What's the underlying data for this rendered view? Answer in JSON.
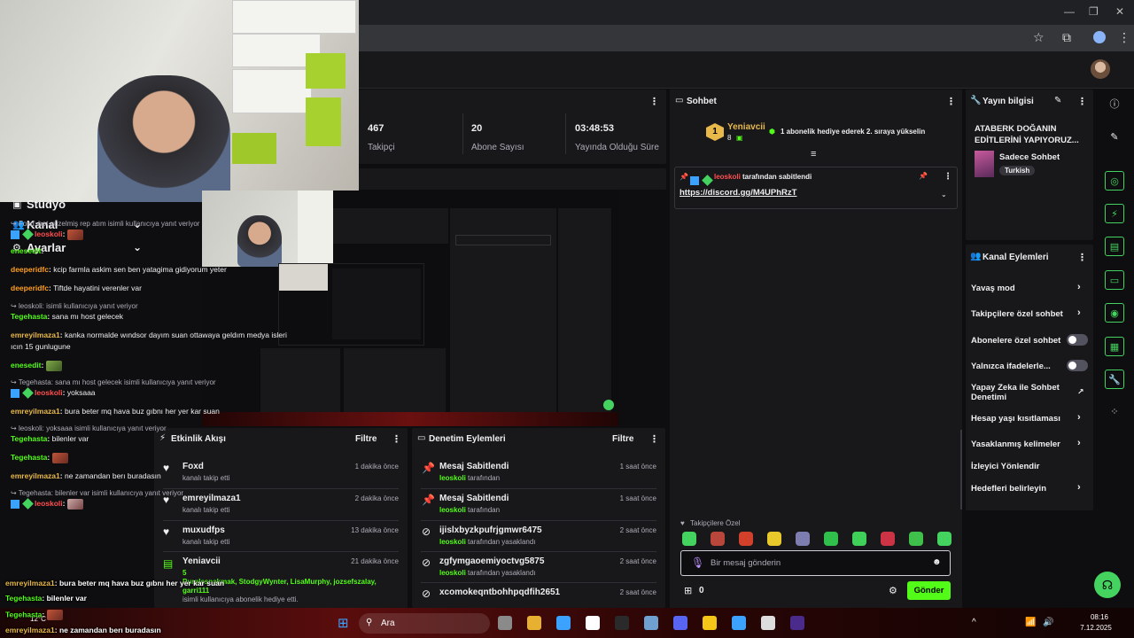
{
  "browser": {
    "star_icon": "star-icon",
    "ext_icon": "puzzle-icon",
    "menu_icon": "kebab-icon"
  },
  "stats": [
    {
      "value": "467",
      "label": "Takipçi"
    },
    {
      "value": "20",
      "label": "Abone Sayısı"
    },
    {
      "value": "03:48:53",
      "label": "Yayında Olduğu Süre"
    }
  ],
  "sidebar": {
    "items": [
      {
        "label": "Stüdyo"
      },
      {
        "label": "Kanal"
      },
      {
        "label": "Ayarlar"
      }
    ]
  },
  "activity": {
    "title": "Etkinlik Akışı",
    "filter": "Filtre",
    "items": [
      {
        "name": "Foxd",
        "sub": "kanalı takip etti",
        "time": "1 dakika önce"
      },
      {
        "name": "emreyilmaza1",
        "sub": "kanalı takip etti",
        "time": "2 dakika önce"
      },
      {
        "name": "muxudfps",
        "sub": "kanalı takip etti",
        "time": "13 dakika önce"
      },
      {
        "name": "Yeniavcii",
        "count": "5",
        "gifted": "Purplesnakmak, StodgyWynter, LisaMurphy, jozsefszalay, garri111",
        "sub": "isimli kullanıcıya abonelik hediye etti.",
        "time": "21 dakika önce"
      }
    ]
  },
  "modlog": {
    "title": "Denetim Eylemleri",
    "filter": "Filtre",
    "items": [
      {
        "name": "Mesaj Sabitlendi",
        "user": "leoskoli",
        "sub": "tarafından",
        "time": "1 saat önce"
      },
      {
        "name": "Mesaj Sabitlendi",
        "user": "leoskoli",
        "sub": "tarafından",
        "time": "1 saat önce"
      },
      {
        "name": "ijislxbyzkpufrjgmwr6475",
        "user": "leoskoli",
        "sub": "tarafından yasaklandı",
        "time": "2 saat önce"
      },
      {
        "name": "zgfymgaoemiyoctvg5875",
        "user": "leoskoli",
        "sub": "tarafından yasaklandı",
        "time": "2 saat önce"
      },
      {
        "name": "xcomokeqntbohhpqdfih2651",
        "user": "",
        "sub": "",
        "time": "2 saat önce"
      }
    ]
  },
  "chat": {
    "title": "Sohbet",
    "top_gifter": {
      "rank": "1",
      "name": "Yeniavcii",
      "count": "8"
    },
    "gift_prompt": "1 abonelik hediye ederek 2. sıraya yükselin",
    "pinned": {
      "by_user": "leoskoli",
      "by_text": "tarafından sabitlendi",
      "link": "https://discord.gg/M4UPhRzT"
    },
    "lines": [
      {
        "reply": "Foxd: bot güzelmiş rep atım isimli kullanıcıya yanıt veriyor"
      },
      {
        "user": "leoskoli",
        "text": ""
      },
      {
        "user": "enesedit",
        "text": ""
      },
      {
        "user": "deeperidfc",
        "text": "kcip farmla askim sen ben yatagima gidiyorum yeter"
      },
      {
        "user": "deeperidfc",
        "text": "Tiftde hayatini verenler var"
      },
      {
        "reply": "leoskoli: isimli kullanıcıya yanıt veriyor"
      },
      {
        "user": "Tegehasta",
        "text": "sana mı host gelecek"
      },
      {
        "user": "emreyilmaza1",
        "text": "kanka normalde wındsor dayım suan ottawaya geldım medya isleri ıcın 15 gunlugune"
      },
      {
        "user": "enesedit",
        "text": ""
      },
      {
        "reply": "Tegehasta: sana mı host gelecek isimli kullanıcıya yanıt veriyor"
      },
      {
        "user": "leoskoli",
        "text": "yoksaaa"
      },
      {
        "user": "emreyilmaza1",
        "text": "bura beter mq hava buz gıbnı her yer kar suan"
      },
      {
        "reply": "leoskoli: yoksaaa isimli kullanıcıya yanıt veriyor"
      },
      {
        "user": "Tegehasta",
        "text": "bilenler var"
      },
      {
        "user": "Tegehasta",
        "text": ""
      },
      {
        "user": "emreyilmaza1",
        "text": "ne zamandan berı buradasın"
      },
      {
        "reply": "Tegehasta: bilenler var isimli kullanıcıya yanıt veriyor"
      },
      {
        "user": "leoskoli",
        "text": ""
      }
    ],
    "follower_label": "Takipçilere Özel",
    "input_placeholder": "Bir mesaj gönderin",
    "points": "0",
    "send_label": "Gönder"
  },
  "stream_info": {
    "title_label": "Yayın bilgisi",
    "stream_title": "ATABERK DOĞANIN EDİTLERİNİ YAPIYORUZ...",
    "category": "Sadece Sohbet",
    "tag": "Turkish"
  },
  "channel_actions": {
    "title": "Kanal Eylemleri",
    "items": [
      {
        "label": "Yavaş mod",
        "kind": "chevron"
      },
      {
        "label": "Takipçilere özel sohbet",
        "kind": "chevron"
      },
      {
        "label": "Abonelere özel sohbet",
        "kind": "toggle"
      },
      {
        "label": "Yalnızca ifadelerle...",
        "kind": "toggle"
      },
      {
        "label": "Yapay Zeka ile Sohbet Denetimi",
        "kind": "external"
      },
      {
        "label": "Hesap yaşı kısıtlaması",
        "kind": "chevron"
      },
      {
        "label": "Yasaklanmış kelimeler",
        "kind": "chevron"
      },
      {
        "label": "İzleyici Yönlendir",
        "kind": "none"
      },
      {
        "label": "Hedefleri belirleyin",
        "kind": "chevron"
      }
    ]
  },
  "overlay_chat": [
    {
      "user": "emreyilmaza1",
      "text": ": bura beter mq hava buz gıbnı her yer kar suan"
    },
    {
      "user": "Tegehasta",
      "text": ": bilenler var"
    },
    {
      "user": "Tegehasta",
      "text": ":"
    },
    {
      "user": "emreyilmaza1",
      "text": ": ne zamandan berı buradasın"
    }
  ],
  "taskbar": {
    "search": "Ara",
    "weather": "12°C",
    "time": "08:16",
    "date": "7.12.2025"
  },
  "colors": {
    "accent": "#53fc18",
    "mod_red": "#ff4f4f",
    "user_green": "#53fc18",
    "user_orange": "#ff9e1f",
    "user_blue": "#3ba3ff"
  }
}
